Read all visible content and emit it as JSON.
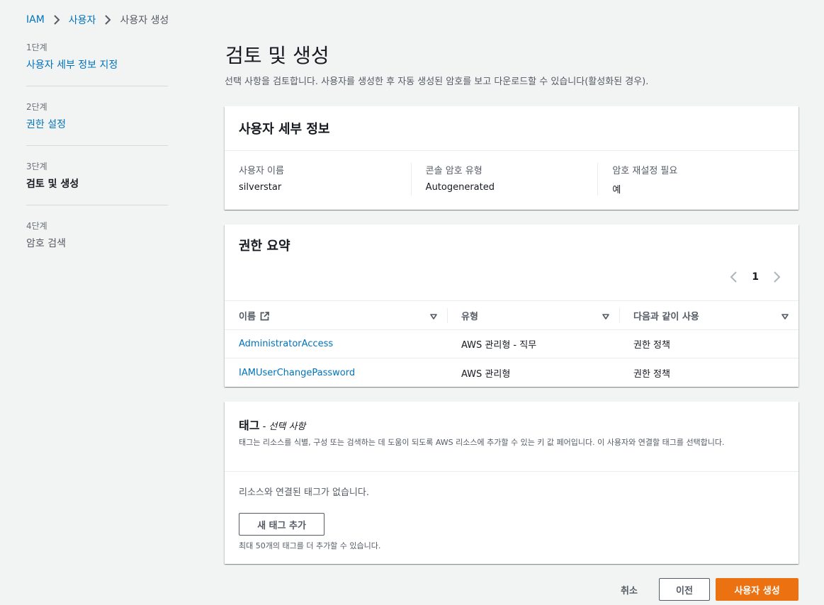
{
  "breadcrumb": {
    "items": [
      "IAM",
      "사용자"
    ],
    "current": "사용자 생성"
  },
  "steps": [
    {
      "num": "1단계",
      "title": "사용자 세부 정보 지정"
    },
    {
      "num": "2단계",
      "title": "권한 설정"
    },
    {
      "num": "3단계",
      "title": "검토 및 생성"
    },
    {
      "num": "4단계",
      "title": "암호 검색"
    }
  ],
  "page": {
    "title": "검토 및 생성",
    "description": "선택 사항을 검토합니다. 사용자를 생성한 후 자동 생성된 암호를 보고 다운로드할 수 있습니다(활성화된 경우)."
  },
  "details": {
    "title": "사용자 세부 정보",
    "fields": [
      {
        "label": "사용자 이름",
        "value": "silverstar"
      },
      {
        "label": "콘솔 암호 유형",
        "value": "Autogenerated"
      },
      {
        "label": "암호 재설정 필요",
        "value": "예"
      }
    ]
  },
  "permissions": {
    "title": "권한 요약",
    "page": "1",
    "columns": [
      "이름",
      "유형",
      "다음과 같이 사용"
    ],
    "rows": [
      {
        "name": "AdministratorAccess",
        "type": "AWS 관리형 - 직무",
        "usage": "권한 정책"
      },
      {
        "name": "IAMUserChangePassword",
        "type": "AWS 관리형",
        "usage": "권한 정책"
      }
    ]
  },
  "tags": {
    "title": "태그",
    "optional": " - 선택 사항",
    "description": "태그는 리소스를 식별, 구성 또는 검색하는 데 도움이 되도록 AWS 리소스에 추가할 수 있는 키 값 페어입니다. 이 사용자와 연결할 태그를 선택합니다.",
    "empty": "리소스와 연결된 태그가 없습니다.",
    "add_button": "새 태그 추가",
    "hint": "최대 50개의 태그를 더 추가할 수 있습니다."
  },
  "footer": {
    "cancel": "취소",
    "previous": "이전",
    "create": "사용자 생성"
  },
  "colors": {
    "link": "#0073bb",
    "primary": "#ec7211",
    "background": "#f2f3f3"
  }
}
